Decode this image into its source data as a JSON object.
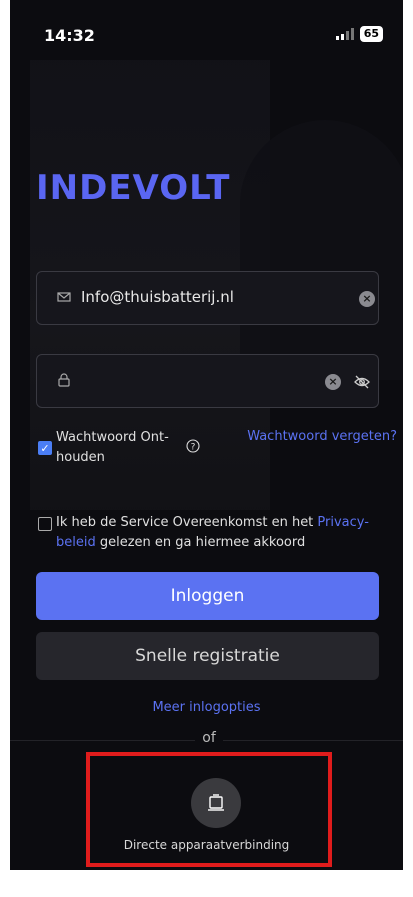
{
  "status": {
    "time": "14:32",
    "battery": "65"
  },
  "brand": {
    "logo": "INDEVOLT",
    "accent": "#5a66f2"
  },
  "login": {
    "email_value": "Info@thuisbatterij.nl",
    "password_value": "",
    "remember_label_1": "Wachtwoord Ont-",
    "remember_label_2": "houden",
    "remember_checked": true,
    "forgot_label": "Wachtwoord vergeten?",
    "agree_text_1": "Ik heb de Service Overeenkomst en het ",
    "agree_link_1": "Privacy-",
    "agree_link_2": "beleid",
    "agree_text_2": " gelezen en ga hiermee akkoord",
    "agree_checked": false,
    "login_button": "Inloggen",
    "register_button": "Snelle registratie",
    "more_options": "Meer inlogopties",
    "or_label": "of",
    "device_connect_label": "Directe apparaatverbinding"
  },
  "icons": {
    "email": "mail-icon",
    "password": "lock-icon",
    "clear": "clear-icon",
    "visibility": "eye-off-icon",
    "help": "help-icon",
    "device": "device-icon"
  }
}
